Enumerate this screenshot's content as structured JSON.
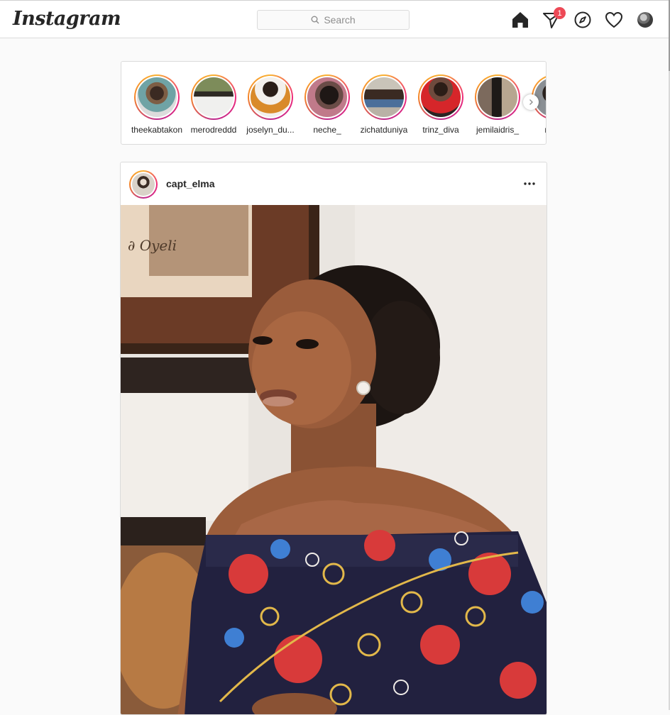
{
  "app": {
    "logo_text": "Instagram"
  },
  "search": {
    "placeholder": "Search",
    "icon": "search-icon"
  },
  "nav": {
    "icons": [
      "home-icon",
      "direct-icon",
      "explore-icon",
      "activity-icon",
      "profile-avatar"
    ],
    "direct_badge": "1"
  },
  "stories": {
    "items": [
      {
        "name": "theekabtakon"
      },
      {
        "name": "merodreddd"
      },
      {
        "name": "joselyn_du..."
      },
      {
        "name": "neche_"
      },
      {
        "name": "zichatduniya"
      },
      {
        "name": "trinz_diva"
      },
      {
        "name": "jemilaidris_"
      },
      {
        "name": "marb"
      }
    ],
    "next_icon": "chevron-right-icon"
  },
  "post": {
    "username": "capt_elma",
    "more_icon": "more-options-icon"
  },
  "colors": {
    "badge": "#ed4956",
    "story_ring_start": "#f9b233",
    "story_ring_end": "#bc2a8d",
    "border": "#dbdbdb",
    "background": "#fafafa"
  }
}
